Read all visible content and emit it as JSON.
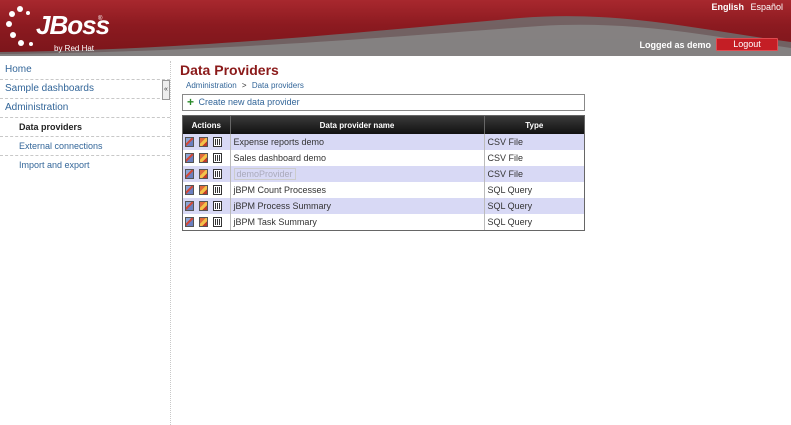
{
  "header": {
    "logo_text": "JBoss",
    "logo_sub": "by Red Hat",
    "logo_reg": "®",
    "languages": [
      "English",
      "Español"
    ],
    "logged_text": "Logged as demo",
    "logout_label": "Logout",
    "colors": {
      "header_bg": "#8c1a20",
      "logout_bg": "#c41e25"
    }
  },
  "sidebar": {
    "items": [
      {
        "label": "Home"
      },
      {
        "label": "Sample dashboards"
      },
      {
        "label": "Administration"
      },
      {
        "label": "Data providers"
      },
      {
        "label": "External connections"
      },
      {
        "label": "Import and export"
      }
    ],
    "toggle_label": "«"
  },
  "main": {
    "title": "Data Providers",
    "breadcrumb": [
      "Administration",
      "Data providers"
    ],
    "breadcrumb_sep": ">",
    "create_label": "Create new data provider",
    "table": {
      "headers": [
        "Actions",
        "Data provider name",
        "Type"
      ],
      "rows": [
        {
          "name": "Expense reports demo",
          "type": "CSV File"
        },
        {
          "name": "Sales dashboard demo",
          "type": "CSV File"
        },
        {
          "name": "demoProvider",
          "type": "CSV File"
        },
        {
          "name": "jBPM Count Processes",
          "type": "SQL Query"
        },
        {
          "name": "jBPM Process Summary",
          "type": "SQL Query"
        },
        {
          "name": "jBPM Task Summary",
          "type": "SQL Query"
        }
      ]
    }
  },
  "icons": [
    "plus-icon",
    "edit-icon",
    "copy-icon",
    "delete-icon"
  ]
}
